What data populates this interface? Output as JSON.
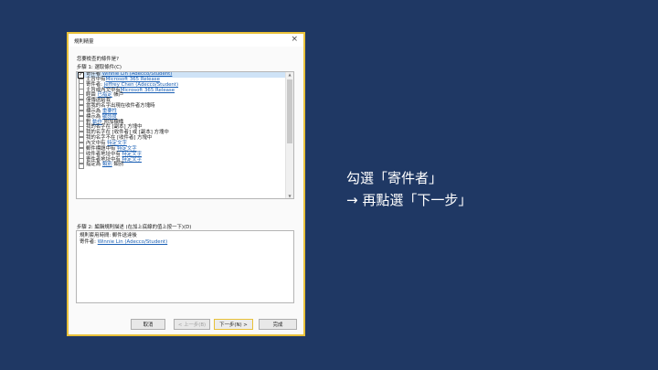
{
  "dialog": {
    "title": "規則精靈",
    "close": "×",
    "question": "您要檢查的條件是?",
    "step1": "步驟 1: 選取條件(C)",
    "conditions": [
      {
        "pre": "寄件者 ",
        "link": "Winnie Lin (Adecco/Student)",
        "post": "",
        "checked": true,
        "selected": true
      },
      {
        "pre": "主旨中有",
        "link": "Microsoft 365 Release",
        "post": "",
        "checked": false
      },
      {
        "pre": "寄件者: ",
        "link": "Jeffrey Chen (Adecco/Student)",
        "post": "",
        "checked": false
      },
      {
        "pre": "主旨或內文中有",
        "link": "Microsoft 365 Release",
        "post": "",
        "checked": false
      },
      {
        "pre": "經由 ",
        "link": "已指定",
        "post": " 帳戶",
        "checked": false
      },
      {
        "pre": "僅傳送給我",
        "link": "",
        "post": "",
        "checked": false
      },
      {
        "pre": "當我的名字出現在收件者方塊時",
        "link": "",
        "post": "",
        "checked": false
      },
      {
        "pre": "標示為 ",
        "link": "重要性",
        "post": "",
        "checked": false
      },
      {
        "pre": "標示為 ",
        "link": "敏感度",
        "post": "",
        "checked": false
      },
      {
        "pre": "對 ",
        "link": "動作",
        "post": " 附加標幟",
        "checked": false
      },
      {
        "pre": "我的名字在 [副本] 方塊中",
        "link": "",
        "post": "",
        "checked": false
      },
      {
        "pre": "我的名字在 [收件者] 或 [副本] 方塊中",
        "link": "",
        "post": "",
        "checked": false
      },
      {
        "pre": "我的名字不在 [收件者] 方塊中",
        "link": "",
        "post": "",
        "checked": false
      },
      {
        "pre": "內文中有 ",
        "link": "特定文字",
        "post": "",
        "checked": false
      },
      {
        "pre": "郵件標題中有 ",
        "link": "特定文字",
        "post": "",
        "checked": false
      },
      {
        "pre": "收件者地址中有 ",
        "link": "特定文字",
        "post": "",
        "checked": false
      },
      {
        "pre": "寄件者地址中有 ",
        "link": "特定文字",
        "post": "",
        "checked": false
      },
      {
        "pre": "指定為 ",
        "link": "類別",
        "post": " 類別",
        "checked": false
      }
    ],
    "step2": "步驟 2: 編輯規則描述 (在加上底線的值上按一下)(D)",
    "desc_line1": "規則套用時間: 郵件送達後",
    "desc_line2_pre": "寄件者: ",
    "desc_line2_link": "Winnie Lin (Adecco/Student)",
    "buttons": {
      "cancel": "取消",
      "back": "< 上一步(B)",
      "next": "下一步(N) >",
      "finish": "完成"
    }
  },
  "annotation": {
    "line1": "勾選「寄件者」",
    "line2": "→ 再點選「下一步」"
  },
  "colors": {
    "background": "#1f3864",
    "highlight": "#e8c13a",
    "link": "#1a5fb4",
    "selection": "#cfe3f7"
  }
}
